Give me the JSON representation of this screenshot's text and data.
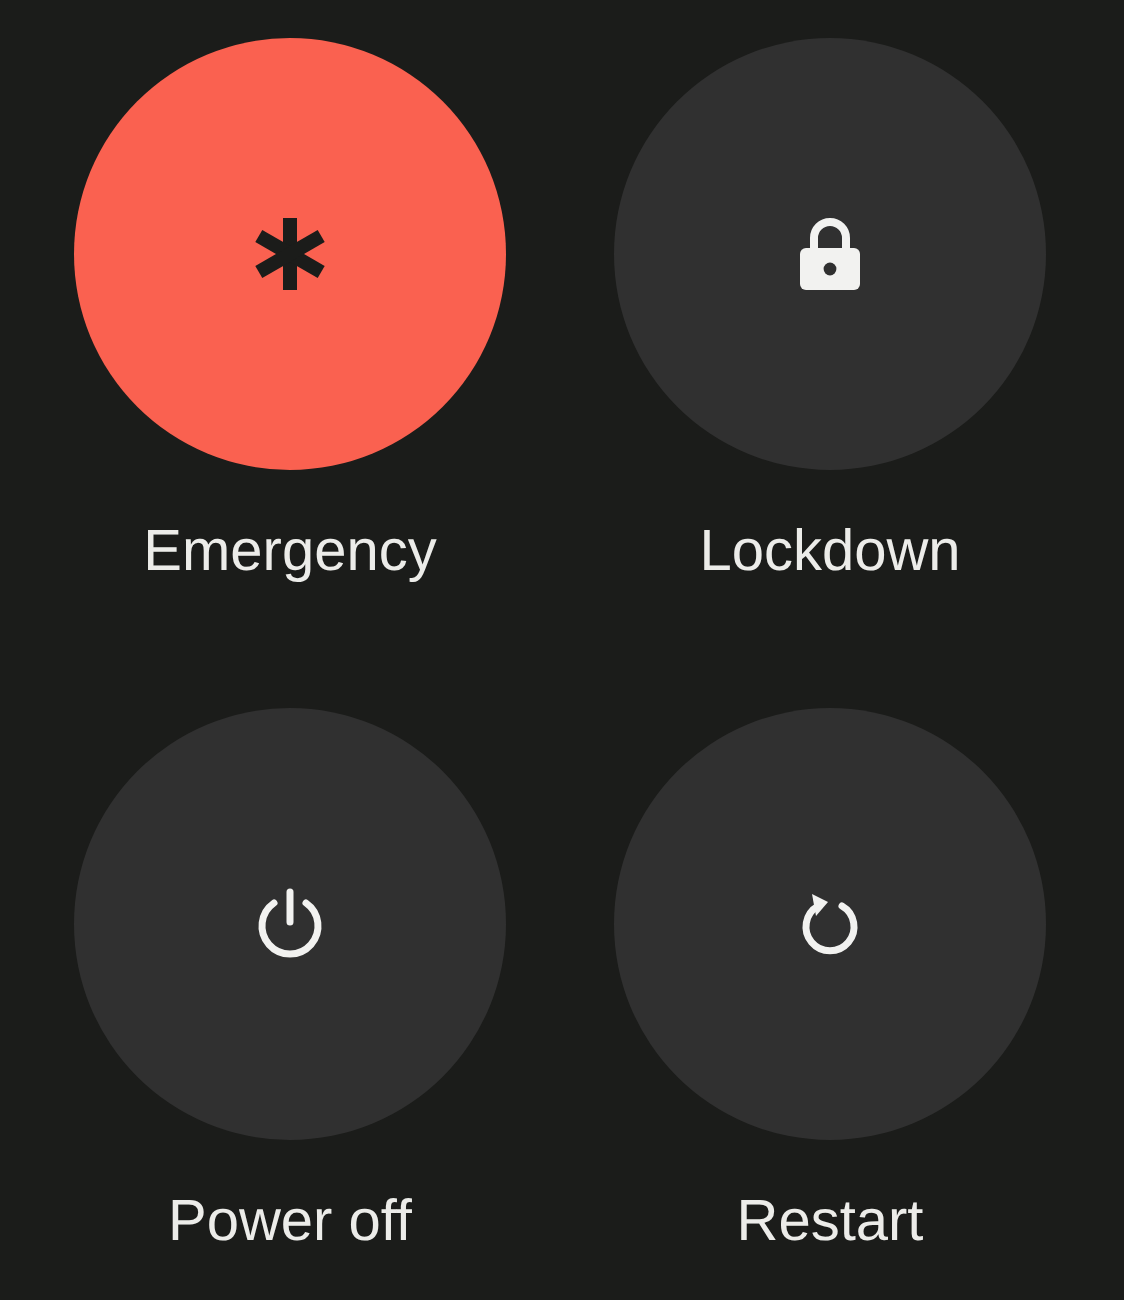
{
  "actions": [
    {
      "kind": "emergency",
      "label": "Emergency",
      "color": "#fa6150"
    },
    {
      "kind": "lockdown",
      "label": "Lockdown",
      "color": "#303030"
    },
    {
      "kind": "power",
      "label": "Power off",
      "color": "#303030"
    },
    {
      "kind": "restart",
      "label": "Restart",
      "color": "#303030"
    }
  ]
}
